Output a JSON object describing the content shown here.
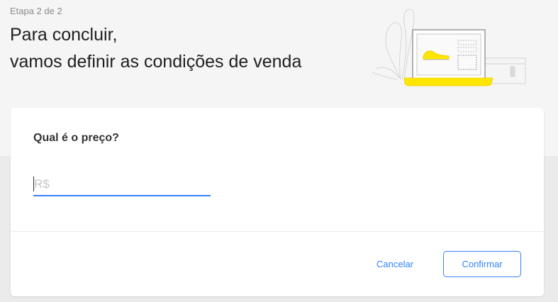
{
  "header": {
    "step": "Etapa 2 de 2",
    "title_line1": "Para concluir,",
    "title_line2": "vamos definir as condições de venda"
  },
  "illustration": {
    "icon": "laptop-sneaker-illustration",
    "accent_color": "#ffe600"
  },
  "form": {
    "question": "Qual é o preço?",
    "price_value": "",
    "price_placeholder": "R$"
  },
  "actions": {
    "cancel_label": "Cancelar",
    "confirm_label": "Confirmar"
  },
  "colors": {
    "accent": "#3483fa",
    "background": "#ebebeb"
  }
}
